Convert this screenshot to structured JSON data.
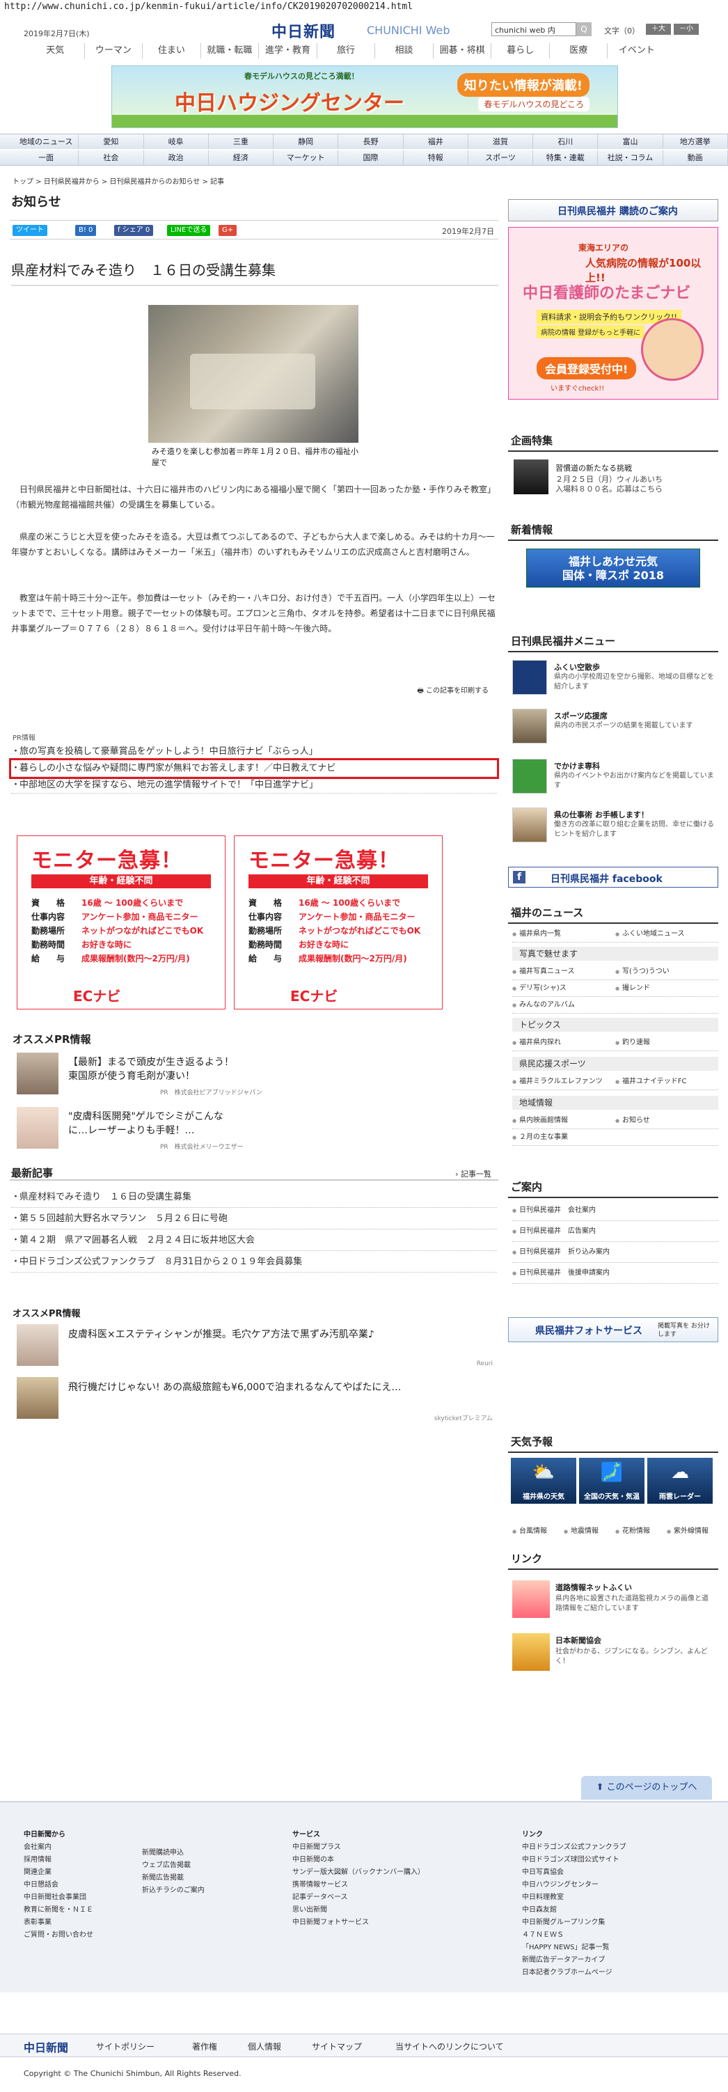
{
  "url": "http://www.chunichi.co.jp/kenmin-fukui/article/info/CK2019020702000214.html",
  "header": {
    "date": "2019年2月7日(木)",
    "logo": "中日新聞",
    "logo_sub": "CHUNICHI Web",
    "search_value": "chunichi web 内",
    "search_button": "Q",
    "fontsize_label": "文字（0）",
    "font_large": "＋大",
    "font_small": "－小"
  },
  "topnav": [
    "天気",
    "ウーマン",
    "住まい",
    "就職・転職",
    "進学・教育",
    "旅行",
    "相談",
    "囲碁・将棋",
    "暮らし",
    "医療",
    "イベント"
  ],
  "banner": {
    "top": "春モデルハウスの見どころ満載！",
    "title": "中日ハウジングセンター",
    "cta": "知りたい情報が満載!",
    "cta2": "春モデルハウスの見どころ"
  },
  "regnav": [
    "地域のニュース",
    "愛知",
    "岐阜",
    "三重",
    "静岡",
    "長野",
    "福井",
    "滋賀",
    "石川",
    "富山",
    "地方選挙"
  ],
  "catnav": [
    "一面",
    "社会",
    "政治",
    "経済",
    "マーケット",
    "国際",
    "特報",
    "スポーツ",
    "特集・連載",
    "社説・コラム",
    "動画"
  ],
  "breadcrumb": "トップ > 日刊県民福井から > 日刊県民福井からのお知らせ > 記事",
  "page_title": "お知らせ",
  "share": {
    "tweet": "ツイート",
    "hatena": "B! 0",
    "fb_share": "f シェア 0",
    "line": "LINEで送る",
    "gplus": "G+",
    "date": "2019年2月7日"
  },
  "article": {
    "headline": "県産材料でみそ造り　１６日の受講生募集",
    "caption": "みそ造りを楽しむ参加者＝昨年１月２０日、福井市の福祉小屋で",
    "paragraphs": [
      "日刊県民福井と中日新聞社は、十六日に福井市のハピリン内にある福福小屋で開く「第四十一回あったか塾・手作りみそ教室」（市観光物産館福福館共催）の受講生を募集している。",
      "県産の米こうじと大豆を使ったみそを造る。大豆は煮てつぶしてあるので、子どもから大人まで楽しめる。みそは約十カ月〜一年寝かすとおいしくなる。講師はみそメーカー「米五」（福井市）のいずれもみそソムリエの広沢成高さんと吉村磨明さん。",
      "教室は午前十時三十分〜正午。参加費は一セット（みそ約一・八キロ分、おけ付き）で千五百円。一人（小学四年生以上）一セットまでで、三十セット用意。親子で一セットの体験も可。エプロンと三角巾、タオルを持参。希望者は十二日までに日刊県民福井事業グループ＝０７７６（２８）８６１８＝へ。受付けは平日午前十時〜午後六時。"
    ],
    "print_link": "この記事を印刷する"
  },
  "pr": {
    "label": "PR情報",
    "items": [
      "旅の写真を投稿して豪華賞品をゲットしよう！中日旅行ナビ「ぶらっ人」",
      "暮らしの小さな悩みや疑問に専門家が無料でお答えします！／中日教えてナビ",
      "中部地区の大学を探すなら、地元の進学情報サイトで！「中日進学ナビ」"
    ]
  },
  "monitor": {
    "title": "モニター急募！",
    "sub": "年齢・経験不問",
    "rows": [
      {
        "k": "資　　格",
        "v": "16歳 〜 100歳くらいまで"
      },
      {
        "k": "仕事内容",
        "v": "アンケート参加・商品モニター"
      },
      {
        "k": "勤務場所",
        "v": "ネットがつながればどこでもOK"
      },
      {
        "k": "勤務時間",
        "v": "お好きな時に"
      },
      {
        "k": "給　　与",
        "v": "成果報酬制(数円〜2万円/月)"
      }
    ],
    "logo": "ECナビ"
  },
  "osusume": {
    "title": "オススメPR情報",
    "items": [
      {
        "text1": "【最新】まるで頭皮が生き返るよう！",
        "text2": "東国原が使う育毛剤が凄い！",
        "src": "PR　株式会社ピアブリッドジャパン"
      },
      {
        "text1": "\"皮膚科医開発\"ゲルでシミがこんな",
        "text2": "に…レーザーよりも手軽！…",
        "src": "PR　株式会社メリーウエザー"
      }
    ]
  },
  "latest": {
    "title": "最新記事",
    "more": "記事一覧",
    "items": [
      "県産材料でみそ造り　１６日の受講生募集",
      "第５５回越前大野名水マラソン　５月２６日に号砲",
      "第４２期　県アマ囲碁名人戦　２月２４日に坂井地区大会",
      "中日ドラゴンズ公式ファンクラブ　８月31日から２０１９年会員募集"
    ]
  },
  "pr2": {
    "title": "オススメPR情報",
    "items": [
      {
        "text": "皮膚科医×エステティシャンが推奨。毛穴ケア方法で黒ずみ汚肌卒業♪",
        "src": "Reuri"
      },
      {
        "text": "飛行機だけじゃない! あの高級旅館も¥6,000で泊まれるなんてやばたにえ…",
        "src": "skyticketプレミアム"
      }
    ]
  },
  "sidebar": {
    "subscribe": "日刊県民福井 購読のご案内",
    "nurse": {
      "a": "東海エリアの",
      "b": "人気病院の情報が100以上!!",
      "c": "中日看護師のたまごナビ",
      "d": "資料請求・説明会予約もワンクリック!!",
      "e": "病院の情報 登録がもっと手軽に",
      "f": "会員登録受付中!",
      "g": "いますぐcheck!!"
    },
    "feature_title": "企画特集",
    "feature": {
      "t1": "習慣道の新たなる挑戦",
      "t2": "２月２５日（月）ウィルあいち",
      "t3": "入場料８００名。応募はこちら"
    },
    "new_title": "新着情報",
    "new_banner": {
      "l1": "福井しあわせ元気",
      "l2": "国体・障スポ 2018"
    },
    "menu_title": "日刊県民福井メニュー",
    "menu": [
      {
        "t": "ふくい空散歩",
        "d": "県内の小学校周辺を空から撮影、地域の目標などを紹介します"
      },
      {
        "t": "スポーツ応援席",
        "d": "県内の市民スポーツの結果を掲載しています"
      },
      {
        "t": "でかけま専科",
        "d": "県内のイベントやお出かけ案内などを掲載しています"
      },
      {
        "t": "県の仕事術 お手帳します！",
        "d": "働き方の改革に取り組む企業を訪問、幸せに働けるヒントを紹介します"
      }
    ],
    "facebook": "日刊県民福井 facebook",
    "fukui_news_title": "福井のニュース",
    "fukui_news": [
      [
        "福井県内一覧",
        "ふくい地域ニュース"
      ]
    ],
    "photo_label": "写真で魅せます",
    "photo_links": [
      [
        "福井写真ニュース",
        "写(うつ)うつい"
      ],
      [
        "デリ写(シャ)ス",
        "撮レンド"
      ],
      [
        "みんなのアルバム",
        ""
      ]
    ],
    "topics_label": "トピックス",
    "topics": [
      [
        "福井県内探れ",
        "釣り速報"
      ]
    ],
    "sports_label": "県民応援スポーツ",
    "sports": [
      [
        "福井ミラクルエレファンツ",
        "福井ユナイテッドFC"
      ]
    ],
    "region_label": "地域情報",
    "region": [
      [
        "県内映画館情報",
        "お知らせ"
      ],
      [
        "２月の主な事業",
        ""
      ]
    ],
    "guide_title": "ご案内",
    "guide": [
      "日刊県民福井　会社案内",
      "日刊県民福井　広告案内",
      "日刊県民福井　折り込み案内",
      "日刊県民福井　後援申請案内"
    ],
    "photo_service": "県民福井フォトサービス",
    "photo_service_sub": "掲載写真を お分けします",
    "weather_title": "天気予報",
    "weather_tiles": [
      "福井県の天気",
      "全国の天気・気温",
      "雨雲レーダー"
    ],
    "weather_links": [
      "台風情報",
      "地震情報",
      "花粉情報",
      "紫外線情報"
    ],
    "link_title": "リンク",
    "links": [
      {
        "t": "道路情報ネットふくい",
        "d": "県内各地に設置された道路監視カメラの画像と道路情報をご紹介しています"
      },
      {
        "t": "日本新聞協会",
        "d": "社会がわかる、ジブンになる。シンブン、よんどく！"
      }
    ]
  },
  "to_top": "このページのトップへ",
  "footer": {
    "col1_title": "中日新聞から",
    "col1": [
      "会社案内",
      "採用情報",
      "関連企業",
      "中日懇話会",
      "中日新聞社会事業団",
      "教育に新聞を・ＮＩＥ",
      "表彰事業",
      "ご質問・お問い合わせ"
    ],
    "col2": [
      "新聞購読申込",
      "ウェブ広告掲載",
      "新聞広告掲載",
      "折込チラシのご案内"
    ],
    "col3_title": "サービス",
    "col3": [
      "中日新聞プラス",
      "中日新聞の本",
      "サンデー版大図解（バックナンバー購入）",
      "携帯情報サービス",
      "記事データベース",
      "思い出新聞",
      "中日新聞フォトサービス"
    ],
    "col4_title": "リンク",
    "col4": [
      "中日ドラゴンズ公式ファンクラブ",
      "中日ドラゴンズ球団公式サイト",
      "中日写真協会",
      "中日ハウジングセンター",
      "中日料理教室",
      "中日森友館",
      "中日新聞グループリンク集",
      "４７ＮＥＷＳ",
      "「HAPPY NEWS」記事一覧",
      "新聞広告データアーカイブ",
      "日本記者クラブホームページ"
    ],
    "bottom_logo": "中日新聞",
    "bottom_links": [
      "サイトポリシー",
      "著作権",
      "個人情報",
      "サイトマップ",
      "当サイトへのリンクについて"
    ],
    "copyright": "Copyright © The Chunichi Shimbun, All Rights Reserved."
  }
}
